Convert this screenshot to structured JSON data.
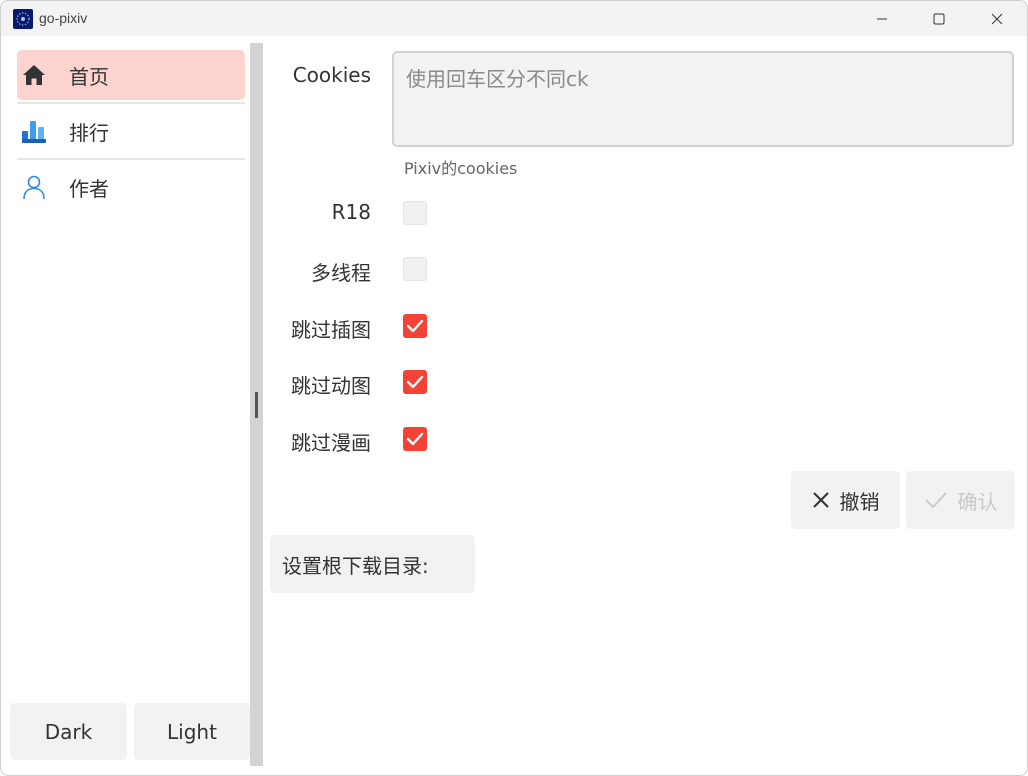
{
  "window": {
    "title": "go-pixiv",
    "icon": "app-logo-icon",
    "controls": [
      "minimize-icon",
      "maximize-icon",
      "close-icon"
    ]
  },
  "sidebar": {
    "items": [
      {
        "label": "首页",
        "icon": "home-icon",
        "active": true
      },
      {
        "label": "排行",
        "icon": "bar-chart-icon",
        "active": false
      },
      {
        "label": "作者",
        "icon": "person-icon",
        "active": false
      }
    ],
    "theme_buttons": {
      "dark": "Dark",
      "light": "Light"
    }
  },
  "form": {
    "cookies": {
      "label": "Cookies",
      "placeholder": "使用回车区分不同ck",
      "value": "",
      "hint": "Pixiv的cookies"
    },
    "options": [
      {
        "label": "R18",
        "checked": false
      },
      {
        "label": "多线程",
        "checked": false
      },
      {
        "label": "跳过插图",
        "checked": true
      },
      {
        "label": "跳过动图",
        "checked": true
      },
      {
        "label": "跳过漫画",
        "checked": true
      }
    ],
    "cancel_label": "撤销",
    "confirm_label": "确认",
    "download_dir_label": "设置根下载目录:"
  },
  "colors": {
    "accent": "#f44336",
    "active_nav_bg": "#fdd3d0",
    "button_bg": "#f2f2f2",
    "disabled_text": "#c9c9c9"
  }
}
